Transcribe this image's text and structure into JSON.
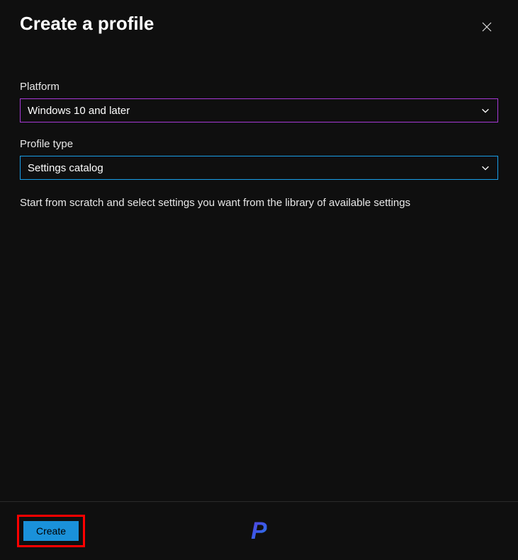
{
  "header": {
    "title": "Create a profile"
  },
  "form": {
    "platform": {
      "label": "Platform",
      "value": "Windows 10 and later"
    },
    "profileType": {
      "label": "Profile type",
      "value": "Settings catalog"
    },
    "description": "Start from scratch and select settings you want from the library of available settings"
  },
  "footer": {
    "createLabel": "Create"
  }
}
